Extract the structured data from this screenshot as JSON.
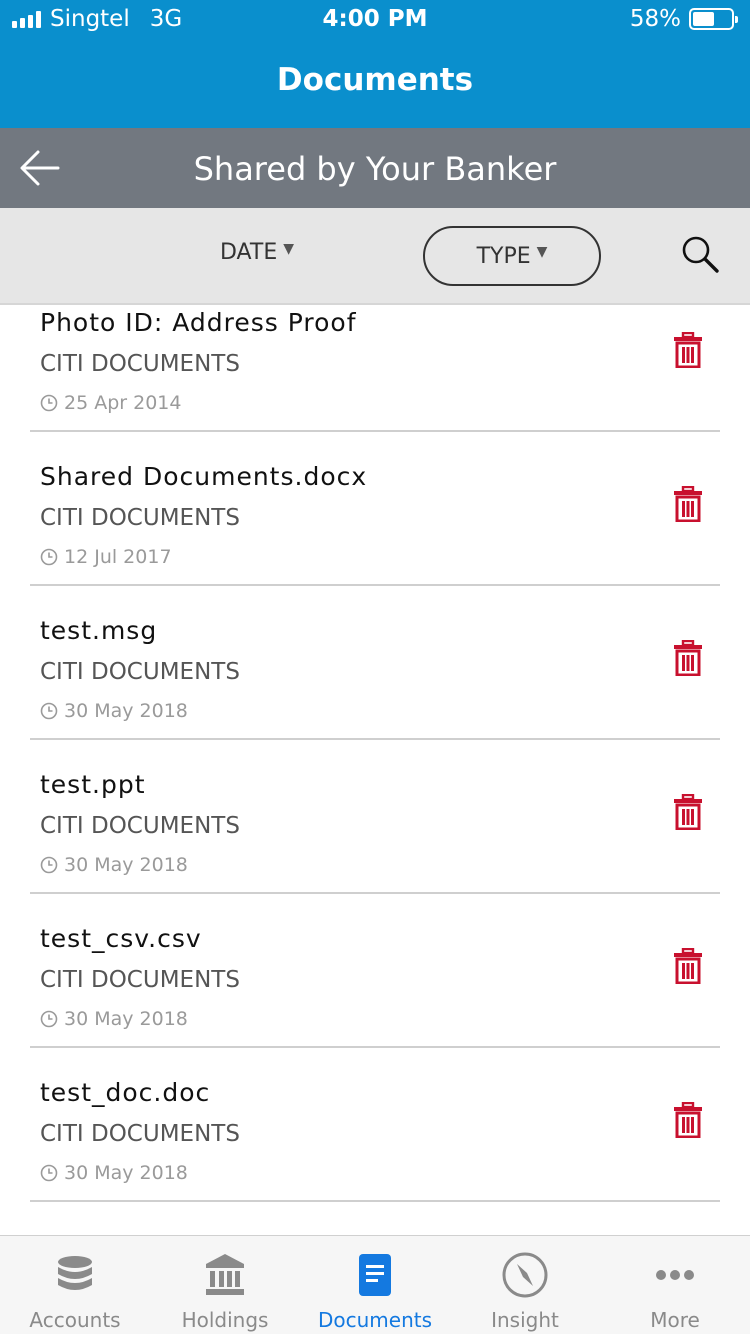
{
  "status_bar": {
    "carrier": "Singtel",
    "network": "3G",
    "time": "4:00 PM",
    "battery": "58%",
    "battery_level": 0.58
  },
  "header": {
    "title": "Documents",
    "subtitle": "Shared by Your Banker",
    "back_icon": "arrow-left-icon"
  },
  "filters": {
    "date_label": "DATE",
    "type_label": "TYPE",
    "search_icon": "search-icon"
  },
  "documents": [
    {
      "name": "Photo ID: Address Proof",
      "category": "CITI DOCUMENTS",
      "date": "25 Apr 2014"
    },
    {
      "name": "Shared Documents.docx",
      "category": "CITI DOCUMENTS",
      "date": "12 Jul 2017"
    },
    {
      "name": "test.msg",
      "category": "CITI DOCUMENTS",
      "date": "30 May 2018"
    },
    {
      "name": "test.ppt",
      "category": "CITI DOCUMENTS",
      "date": "30 May 2018"
    },
    {
      "name": "test_csv.csv",
      "category": "CITI DOCUMENTS",
      "date": "30 May 2018"
    },
    {
      "name": "test_doc.doc",
      "category": "CITI DOCUMENTS",
      "date": "30 May 2018"
    }
  ],
  "tabs": [
    {
      "label": "Accounts",
      "icon": "database-icon",
      "active": false
    },
    {
      "label": "Holdings",
      "icon": "bank-icon",
      "active": false
    },
    {
      "label": "Documents",
      "icon": "document-icon",
      "active": true
    },
    {
      "label": "Insight",
      "icon": "compass-icon",
      "active": false
    },
    {
      "label": "More",
      "icon": "more-dots-icon",
      "active": false
    }
  ],
  "colors": {
    "header_blue": "#0a8fcd",
    "subheader_gray": "#727880",
    "delete_red": "#c8102e",
    "active_tab": "#1479e0",
    "inactive_tab": "#8a8a8a"
  }
}
